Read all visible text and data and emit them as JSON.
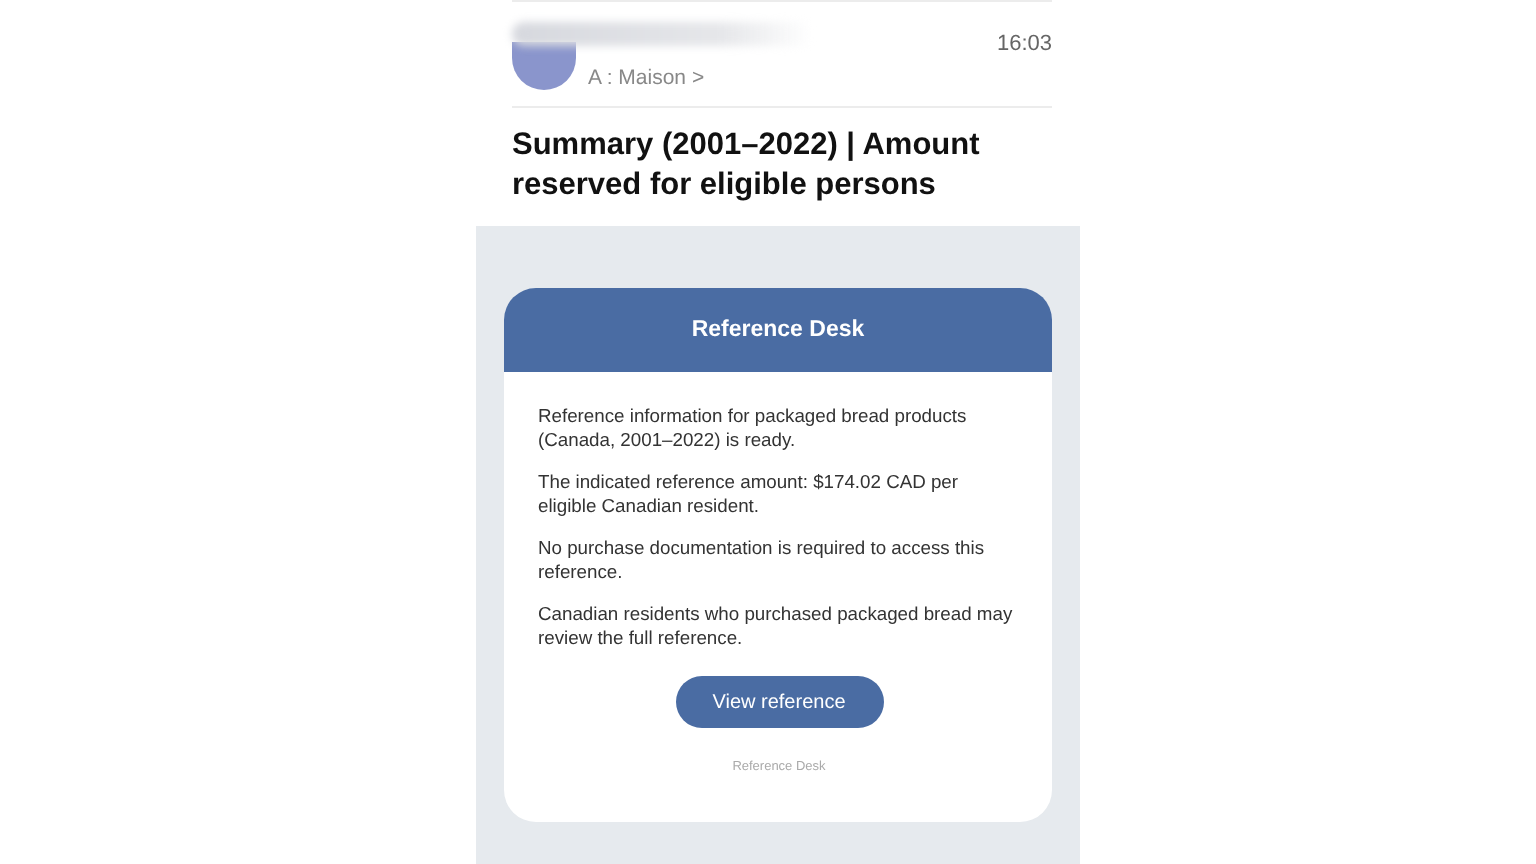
{
  "email": {
    "time": "16:03",
    "recipient": "A : Maison",
    "recipient_chevron": ">",
    "subject": "Summary (2001–2022) | Amount reserved for eligible persons"
  },
  "card": {
    "header": "Reference Desk",
    "paragraphs": [
      "Reference information for packaged bread products (Canada, 2001–2022) is ready.",
      "The indicated reference amount: $174.02 CAD per eligible Canadian resident.",
      "No purchase documentation is required to access this reference.",
      "Canadian residents who purchased packaged bread may review the full reference."
    ],
    "button": "View reference",
    "footer": "Reference Desk"
  }
}
